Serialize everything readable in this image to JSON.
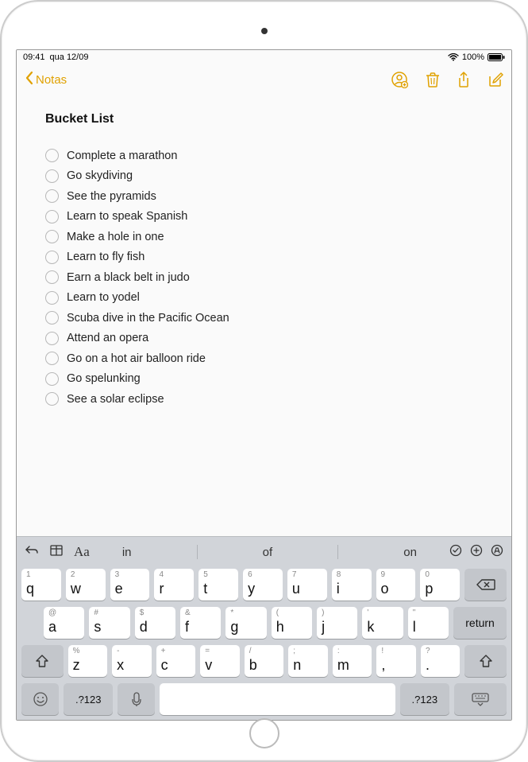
{
  "status": {
    "time": "09:41",
    "date": "qua 12/09",
    "battery": "100%"
  },
  "nav": {
    "back_label": "Notas"
  },
  "note": {
    "title": "Bucket List",
    "items": [
      "Complete a marathon",
      "Go skydiving",
      "See the pyramids",
      "Learn to speak Spanish",
      "Make a hole in one",
      "Learn to fly fish",
      "Earn a black belt in judo",
      "Learn to yodel",
      "Scuba dive in the Pacific Ocean",
      "Attend an opera",
      "Go on a hot air balloon ride",
      "Go spelunking",
      "See a solar eclipse"
    ]
  },
  "keyboard": {
    "suggestions": [
      "in",
      "of",
      "on"
    ],
    "row1": [
      {
        "k": "q",
        "a": "1"
      },
      {
        "k": "w",
        "a": "2"
      },
      {
        "k": "e",
        "a": "3"
      },
      {
        "k": "r",
        "a": "4"
      },
      {
        "k": "t",
        "a": "5"
      },
      {
        "k": "y",
        "a": "6"
      },
      {
        "k": "u",
        "a": "7"
      },
      {
        "k": "i",
        "a": "8"
      },
      {
        "k": "o",
        "a": "9"
      },
      {
        "k": "p",
        "a": "0"
      }
    ],
    "row2": [
      {
        "k": "a",
        "a": "@"
      },
      {
        "k": "s",
        "a": "#"
      },
      {
        "k": "d",
        "a": "$"
      },
      {
        "k": "f",
        "a": "&"
      },
      {
        "k": "g",
        "a": "*"
      },
      {
        "k": "h",
        "a": "("
      },
      {
        "k": "j",
        "a": ")"
      },
      {
        "k": "k",
        "a": "'"
      },
      {
        "k": "l",
        "a": "\""
      }
    ],
    "row3": [
      {
        "k": "z",
        "a": "%"
      },
      {
        "k": "x",
        "a": "-"
      },
      {
        "k": "c",
        "a": "+"
      },
      {
        "k": "v",
        "a": "="
      },
      {
        "k": "b",
        "a": "/"
      },
      {
        "k": "n",
        "a": ";"
      },
      {
        "k": "m",
        "a": ":"
      },
      {
        "k": ",",
        "a": "!"
      },
      {
        "k": ".",
        "a": "?"
      }
    ],
    "return_label": "return",
    "numsym_label": ".?123"
  }
}
